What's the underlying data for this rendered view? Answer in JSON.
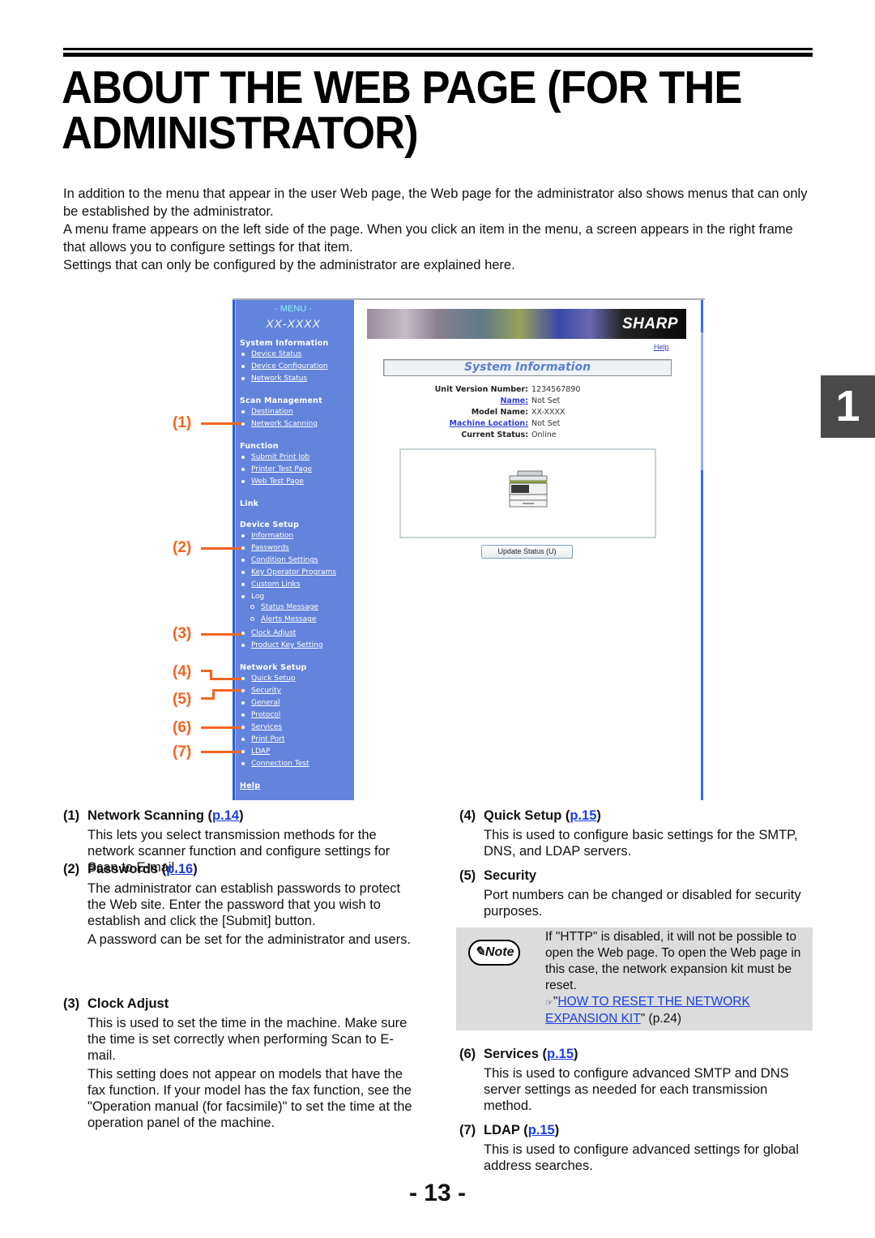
{
  "header": {
    "title": "About the Web page (for the administrator)"
  },
  "intro": [
    "In addition to the menu that appear in the user Web page, the Web page for the administrator also shows menus that can only be established by the administrator.",
    "A menu frame appears on the left side of the page. When you click an item in the menu, a screen appears in the right frame that allows you to configure settings for that item.",
    "Settings that can only be configured by the administrator are explained here."
  ],
  "chapter_tab": "1",
  "screenshot": {
    "menu": {
      "title": "- MENU -",
      "model": "XX-XXXX",
      "sections": {
        "system_information": "System Information",
        "scan_management": "Scan Management",
        "function": "Function",
        "link": "Link",
        "device_setup": "Device Setup",
        "network_setup": "Network Setup",
        "help": "Help"
      },
      "items": {
        "device_status": "Device Status",
        "device_configuration": "Device Configuration",
        "network_status": "Network Status",
        "destination": "Destination",
        "network_scanning": "Network Scanning",
        "submit_print_job": "Submit Print Job",
        "printer_test_page": "Printer Test Page",
        "web_test_page": "Web Test Page",
        "information": "Information",
        "passwords": "Passwords",
        "condition_settings": "Condition Settings",
        "key_operator_programs": "Key Operator Programs",
        "custom_links": "Custom Links",
        "log": "Log",
        "status_message": "Status Message",
        "alerts_message": "Alerts Message",
        "clock_adjust": "Clock Adjust",
        "product_key_setting": "Product Key Setting",
        "quick_setup": "Quick Setup",
        "security": "Security",
        "general": "General",
        "protocol": "Protocol",
        "services": "Services",
        "print_port": "Print Port",
        "ldap": "LDAP",
        "connection_test": "Connection Test"
      }
    },
    "banner_brand": "SHARP",
    "help_link": "Help",
    "section_title": "System Information",
    "info": [
      {
        "key": "Unit Version Number:",
        "value": "1234567890"
      },
      {
        "key": "Name:",
        "value": "Not Set"
      },
      {
        "key": "Model Name:",
        "value": "XX-XXXX"
      },
      {
        "key": "Machine Location:",
        "value": "Not Set"
      },
      {
        "key": "Current Status:",
        "value": "Online"
      }
    ],
    "update_button": "Update Status (U)"
  },
  "callouts": [
    "(1)",
    "(2)",
    "(3)",
    "(4)",
    "(5)",
    "(6)",
    "(7)"
  ],
  "descriptions": [
    {
      "num": "(1)",
      "title": "Network Scanning",
      "page": "p.14",
      "body": [
        "This lets you select transmission methods for the network scanner function and configure settings for Scan to E-mail."
      ]
    },
    {
      "num": "(2)",
      "title": "Passwords",
      "page": "p.16",
      "body": [
        "The administrator can establish passwords to protect the Web site. Enter the password that you wish to establish and click the [Submit] button.",
        "A password can be set for the administrator and users."
      ]
    },
    {
      "num": "(3)",
      "title": "Clock Adjust",
      "page": null,
      "body": [
        "This is used to set the time in the machine. Make sure the time is set correctly when performing Scan to E-mail.",
        "This setting does not appear on models that have the fax function. If your model has the fax function, see the \"Operation manual (for facsimile)\" to set the time at the operation panel of the machine."
      ]
    },
    {
      "num": "(4)",
      "title": "Quick Setup",
      "page": "p.15",
      "body": [
        "This is used to configure basic settings for the SMTP, DNS, and LDAP servers."
      ]
    },
    {
      "num": "(5)",
      "title": "Security",
      "page": null,
      "body": [
        "Port numbers can be changed or disabled for security purposes."
      ]
    },
    {
      "num": "(6)",
      "title": "Services",
      "page": "p.15",
      "body": [
        "This is used to configure advanced SMTP and DNS server settings as needed for each transmission method."
      ]
    },
    {
      "num": "(7)",
      "title": "LDAP",
      "page": "p.15",
      "body": [
        "This is used to configure advanced settings for global address searches."
      ]
    }
  ],
  "note": {
    "badge": "Note",
    "text": "If \"HTTP\" is disabled, it will not be possible to open the Web page. To open the Web page in this case, the network expansion kit must be reset.",
    "ref_icon": "☞",
    "ref_link": "HOW TO RESET THE NETWORK EXPANSION KIT",
    "ref_page": "(p.24)"
  },
  "page_number": "- 13 -"
}
